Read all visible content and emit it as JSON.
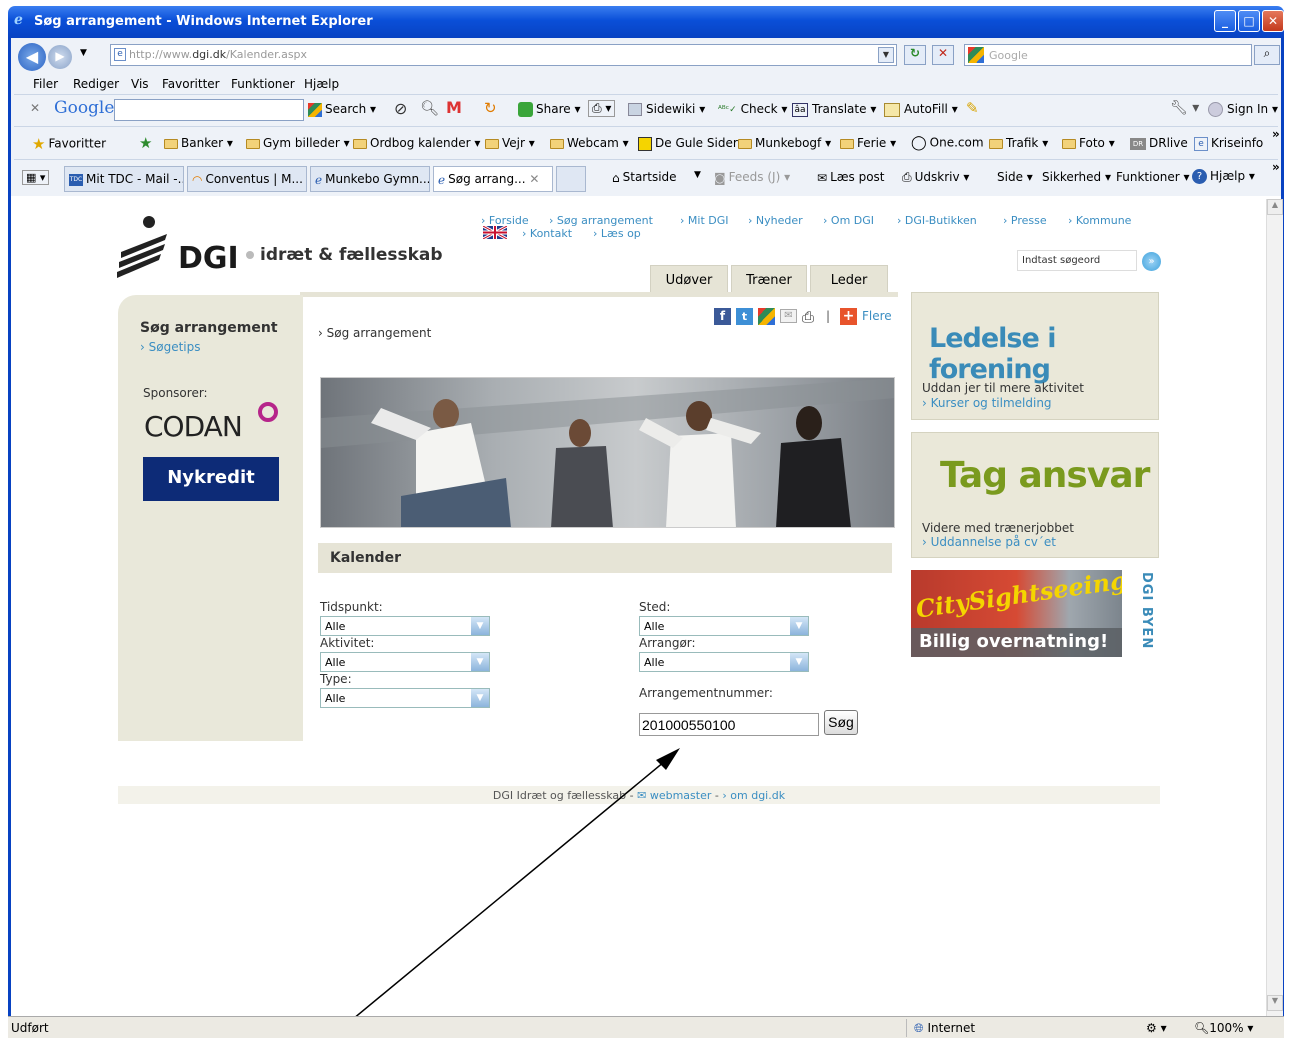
{
  "window": {
    "title": "Søg arrangement - Windows Internet Explorer"
  },
  "address": {
    "url_prefix": "http://www.",
    "url_domain": "dgi.dk",
    "url_path": "/Kalender.aspx",
    "search_placeholder": "Google"
  },
  "menu": [
    "Filer",
    "Rediger",
    "Vis",
    "Favoritter",
    "Funktioner",
    "Hjælp"
  ],
  "google_toolbar": {
    "brand": "Google",
    "search": "Search",
    "share": "Share",
    "sidewiki": "Sidewiki",
    "check": "Check",
    "translate": "Translate",
    "autofill": "AutoFill",
    "signin": "Sign In"
  },
  "favorites_bar": {
    "favoritter": "Favoritter",
    "items": [
      "Banker",
      "Gym billeder",
      "Ordbog kalender",
      "Vejr",
      "Webcam",
      "De Gule Sider",
      "Munkebogf",
      "Ferie",
      "One.com",
      "Trafik",
      "Foto",
      "DRlive",
      "Kriseinfo"
    ]
  },
  "tabs": [
    "Mit TDC - Mail -...",
    "Conventus | M...",
    "Munkebo Gymn...",
    "Søg arrang..."
  ],
  "command_bar": {
    "startside": "Startside",
    "feeds": "Feeds (J)",
    "laes_post": "Læs post",
    "udskriv": "Udskriv",
    "side": "Side",
    "sikkerhed": "Sikkerhed",
    "funktioner": "Funktioner",
    "hjaelp": "Hjælp"
  },
  "site": {
    "logo_text": "DGI",
    "tagline": "idræt & fællesskab",
    "top_nav": [
      "Forside",
      "Søg arrangement",
      "Mit DGI",
      "Nyheder",
      "Om DGI",
      "DGI-Butikken",
      "Presse",
      "Kommune"
    ],
    "top_nav2": [
      "Kontakt",
      "Læs op"
    ],
    "search_placeholder": "Indtast søgeord",
    "audience_tabs": [
      "Udøver",
      "Træner",
      "Leder"
    ],
    "sidebar_title": "Søg arrangement",
    "sidebar_link": "Søgetips",
    "sponsors_label": "Sponsorer:",
    "sponsor1": "CODAN",
    "sponsor2": "Nykredit",
    "breadcrumb": "Søg arrangement",
    "share_more": "Flere",
    "section_title": "Kalender",
    "form": {
      "tidspunkt_label": "Tidspunkt:",
      "tidspunkt_value": "Alle",
      "aktivitet_label": "Aktivitet:",
      "aktivitet_value": "Alle",
      "type_label": "Type:",
      "type_value": "Alle",
      "sted_label": "Sted:",
      "sted_value": "Alle",
      "arrangor_label": "Arrangør:",
      "arrangor_value": "Alle",
      "nummer_label": "Arrangementnummer:",
      "nummer_value": "201000550100",
      "search_button": "Søg"
    },
    "ad1": {
      "title": "Ledelse i forening",
      "text": "Uddan jer til mere aktivitet",
      "link": "Kurser og tilmelding"
    },
    "ad2": {
      "title": "Tag ansvar",
      "text": "Videre med trænerjobbet",
      "link": "Uddannelse på cv´et"
    },
    "ad3": {
      "banner": "Billig overnatning!",
      "brand": "DGI BYEN",
      "image_text": "CitySightseeing"
    },
    "footer": {
      "org": "DGI Idræt og fællesskab",
      "webmaster": "webmaster",
      "about": "om dgi.dk"
    }
  },
  "status": {
    "left": "Udført",
    "zone": "Internet",
    "zoom": "100%"
  }
}
